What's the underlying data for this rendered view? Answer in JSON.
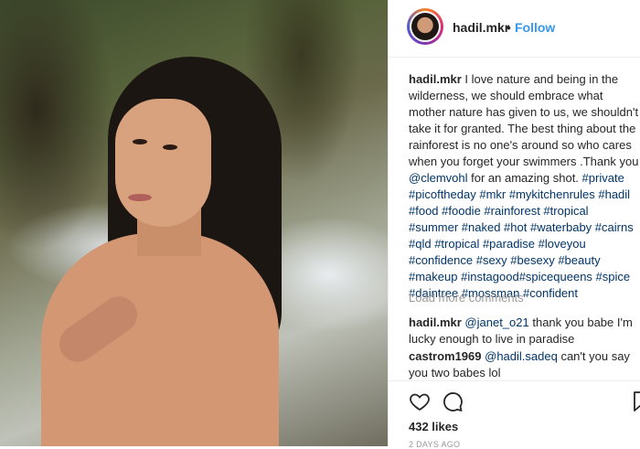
{
  "post": {
    "username": "hadil.mkr",
    "separator": "•",
    "follow_label": "Follow",
    "caption_text": "I love nature and being in the wilderness, we should embrace what mother nature has given to us, we shouldn't take it for granted. The best thing about the rainforest is no one's around so who cares when you forget your swimmers .Thank you",
    "caption_mention": "@clemvohl",
    "caption_after_mention": "for an amazing shot.",
    "hashtags": "#private #picoftheday #mkr #mykitchenrules #hadil #food #foodie #rainforest #tropical #summer #naked #hot #waterbaby #cairns #qld #tropical #paradise #loveyou #confidence #sexy #besexy #beauty #makeup #instagood#spicequeens #spice #daintree #mossman #confident",
    "load_more": "Load more comments",
    "likes": "432 likes",
    "timestamp": "2 DAYS AGO"
  },
  "comments": [
    {
      "username": "hadil.mkr",
      "mention": "@janet_o21",
      "text": "thank you babe I'm lucky enough to live in paradise"
    },
    {
      "username": "castrom1969",
      "mention": "@hadil.sadeq",
      "text": "can't you say you two babes lol"
    }
  ],
  "icons": [
    "heart-icon",
    "comment-icon",
    "bookmark-icon"
  ],
  "colors": {
    "link": "#3897f0",
    "hashtag": "#003569",
    "muted": "#999999"
  }
}
